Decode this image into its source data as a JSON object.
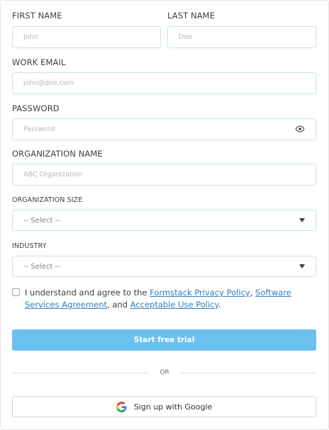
{
  "form": {
    "first_name": {
      "label": "FIRST NAME",
      "placeholder": "John",
      "value": ""
    },
    "last_name": {
      "label": "LAST NAME",
      "placeholder": "Doe",
      "value": ""
    },
    "work_email": {
      "label": "WORK EMAIL",
      "placeholder": "john@doe.com",
      "value": ""
    },
    "password": {
      "label": "PASSWORD",
      "placeholder": "Password",
      "value": "",
      "toggle_icon": "eye-icon"
    },
    "organization_name": {
      "label": "ORGANIZATION NAME",
      "placeholder": "ABC Organization",
      "value": ""
    },
    "organization_size": {
      "label": "ORGANIZATION SIZE",
      "selected": "-- Select --"
    },
    "industry": {
      "label": "INDUSTRY",
      "selected": "-- Select --"
    }
  },
  "agreement": {
    "checked": false,
    "text_before": "I understand and agree to the ",
    "link_privacy": "Formstack Privacy Policy",
    "sep1": ", ",
    "link_software": "Software Services Agreement",
    "sep2": ", and ",
    "link_acceptable": "Acceptable Use Policy",
    "text_end": "."
  },
  "actions": {
    "submit_label": "Start free trial",
    "or_label": "OR",
    "google_label": "Sign up with Google",
    "google_icon": "google-icon"
  },
  "colors": {
    "primary_button": "#6cc0f0",
    "input_border": "#c9e3e6",
    "link": "#2f7fbd"
  }
}
